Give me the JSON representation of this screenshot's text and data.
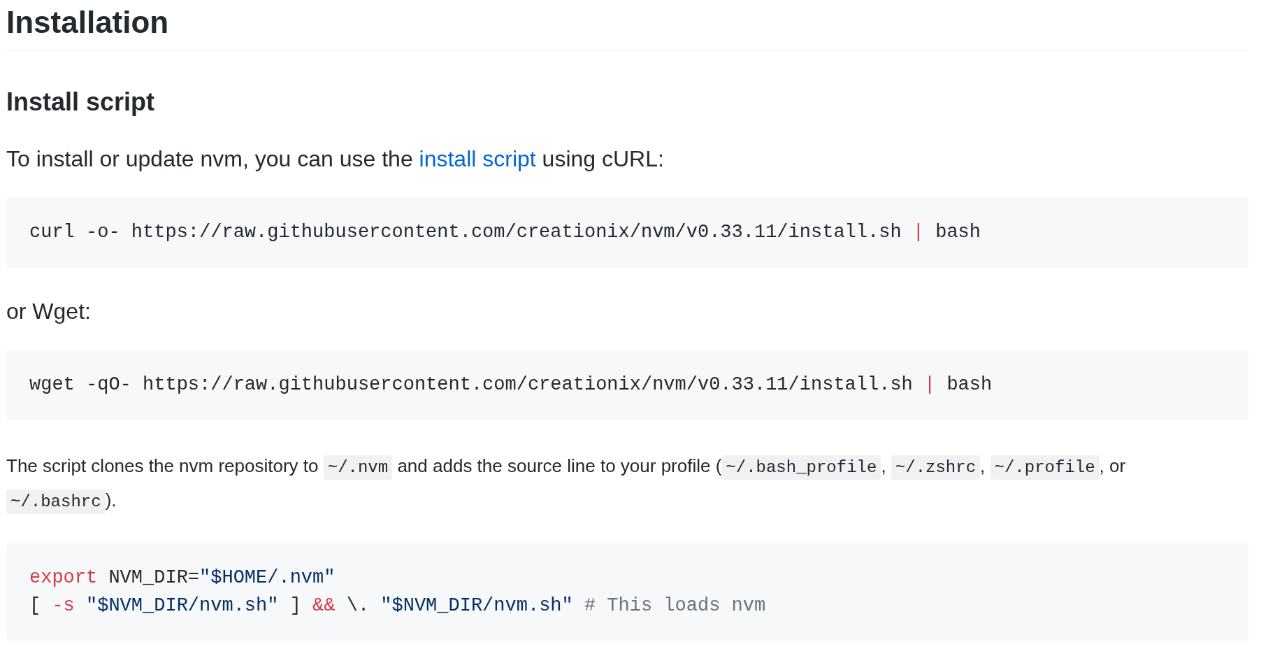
{
  "heading": "Installation",
  "subheading": "Install script",
  "blocks": [
    {
      "kind": "paragraph",
      "segments": [
        {
          "kind": "text",
          "text": "To install or update nvm, you can use the "
        },
        {
          "kind": "link",
          "text": "install script"
        },
        {
          "kind": "text",
          "text": " using cURL:"
        }
      ]
    },
    {
      "kind": "code",
      "lines": [
        [
          {
            "kind": "plain",
            "text": "curl -o- https://raw.githubusercontent.com/creationix/nvm/v0.33.11/install.sh "
          },
          {
            "kind": "keyword",
            "text": "|"
          },
          {
            "kind": "plain",
            "text": " bash"
          }
        ]
      ]
    },
    {
      "kind": "paragraph",
      "segments": [
        {
          "kind": "text",
          "text": "or Wget:"
        }
      ]
    },
    {
      "kind": "code",
      "lines": [
        [
          {
            "kind": "plain",
            "text": "wget -qO- https://raw.githubusercontent.com/creationix/nvm/v0.33.11/install.sh "
          },
          {
            "kind": "keyword",
            "text": "|"
          },
          {
            "kind": "plain",
            "text": " bash"
          }
        ]
      ]
    },
    {
      "kind": "note",
      "segments": [
        {
          "kind": "text",
          "text": "The script clones the nvm repository to "
        },
        {
          "kind": "code",
          "text": "~/.nvm"
        },
        {
          "kind": "text",
          "text": " and adds the source line to your profile ("
        },
        {
          "kind": "code",
          "text": "~/.bash_profile"
        },
        {
          "kind": "text",
          "text": ", "
        },
        {
          "kind": "code",
          "text": "~/.zshrc"
        },
        {
          "kind": "text",
          "text": ", "
        },
        {
          "kind": "code",
          "text": "~/.profile"
        },
        {
          "kind": "text",
          "text": ", or "
        },
        {
          "kind": "code",
          "text": "~/.bashrc"
        },
        {
          "kind": "text",
          "text": ")."
        }
      ]
    },
    {
      "kind": "code",
      "lines": [
        [
          {
            "kind": "keyword",
            "text": "export"
          },
          {
            "kind": "plain",
            "text": " NVM_DIR="
          },
          {
            "kind": "string",
            "text": "\"$HOME/.nvm\""
          }
        ],
        [
          {
            "kind": "plain",
            "text": "[ "
          },
          {
            "kind": "keyword",
            "text": "-s"
          },
          {
            "kind": "string",
            "text": " \"$NVM_DIR/nvm.sh\""
          },
          {
            "kind": "plain",
            "text": " ] "
          },
          {
            "kind": "keyword",
            "text": "&&"
          },
          {
            "kind": "plain",
            "text": " \\. "
          },
          {
            "kind": "string",
            "text": "\"$NVM_DIR/nvm.sh\""
          },
          {
            "kind": "comment",
            "text": " # This loads nvm"
          }
        ]
      ]
    }
  ]
}
